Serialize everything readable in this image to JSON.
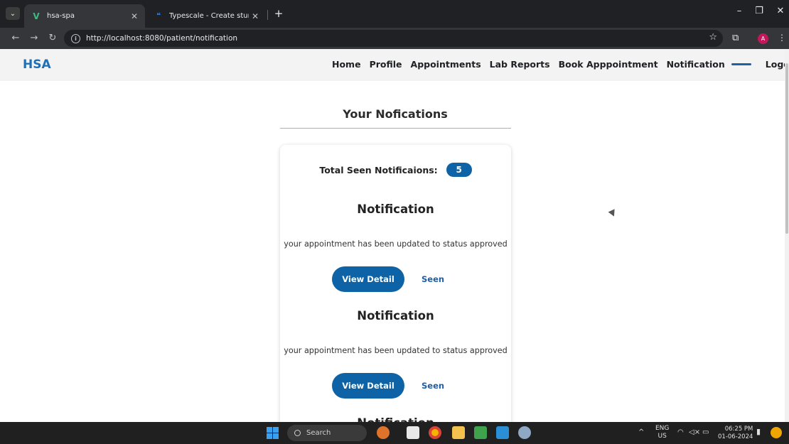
{
  "browser": {
    "tabs": [
      {
        "title": "hsa-spa",
        "active": true
      },
      {
        "title": "Typescale - Create stunning typ",
        "active": false
      }
    ],
    "url": "http://localhost:8080/patient/notification",
    "profile_initial": "A"
  },
  "app": {
    "brand": "HSA",
    "nav_items": [
      "Home",
      "Profile",
      "Appointments",
      "Lab Reports",
      "Book Apppointment",
      "Notification"
    ],
    "active_nav": "Notification",
    "logout_label": "Logout"
  },
  "page": {
    "title": "Your Nofications",
    "total_seen_label": "Total Seen Notificaions:",
    "total_seen_count": "5",
    "notifications": [
      {
        "title": "Notification",
        "message": "your appointment has been updated to status approved",
        "view_label": "View Detail",
        "seen_label": "Seen"
      },
      {
        "title": "Notification",
        "message": "your appointment has been updated to status approved",
        "view_label": "View Detail",
        "seen_label": "Seen"
      },
      {
        "title": "Notification"
      }
    ]
  },
  "taskbar": {
    "search_label": "Search",
    "language": "ENG",
    "region": "US",
    "time": "06:25 PM",
    "date": "01-06-2024"
  },
  "colors": {
    "primary": "#0d63a5",
    "brand": "#1f6fb5",
    "nav_background": "#f3f3f3"
  }
}
